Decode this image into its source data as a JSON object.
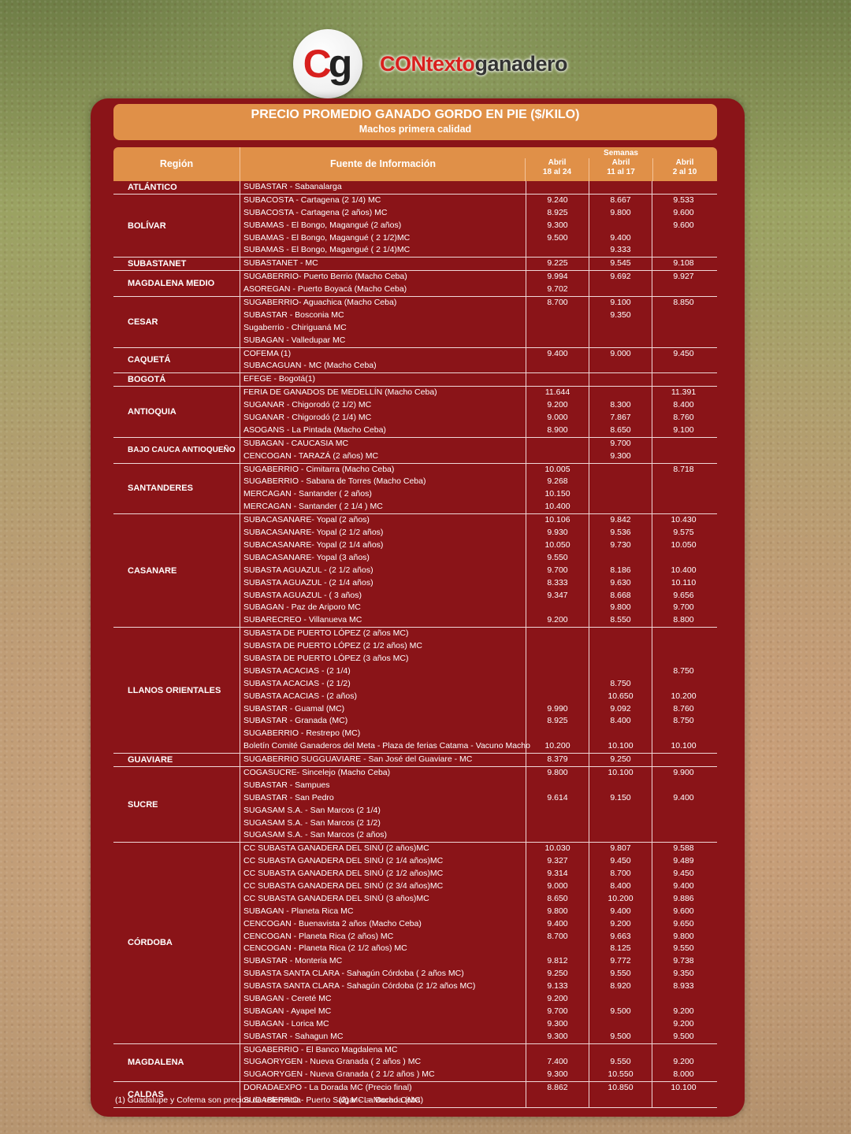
{
  "brand": {
    "logo_c": "C",
    "logo_g": "g",
    "name_red": "CONtexto",
    "name_dark": "ganadero"
  },
  "title": "PRECIO PROMEDIO GANADO GORDO EN PIE ($/KILO)",
  "subtitle": "Machos primera calidad",
  "header": {
    "region": "Región",
    "fuente": "Fuente de Información",
    "semanas": "Semanas",
    "weeks": [
      {
        "month": "Abril",
        "range": "18 al 24"
      },
      {
        "month": "Abril",
        "range": "11 al 17"
      },
      {
        "month": "Abril",
        "range": "2 al 10"
      }
    ]
  },
  "groups": [
    {
      "region": "ATLÁNTICO",
      "rows": [
        [
          "SUBASTAR - Sabanalarga",
          "",
          "",
          ""
        ]
      ]
    },
    {
      "region": "BOLÍVAR",
      "rows": [
        [
          "SUBACOSTA - Cartagena (2 1/4) MC",
          "9.240",
          "8.667",
          "9.533"
        ],
        [
          "SUBACOSTA - Cartagena (2 años) MC",
          "8.925",
          "9.800",
          "9.600"
        ],
        [
          "SUBAMAS - El Bongo, Magangué (2 años)",
          "9.300",
          "",
          "9.600"
        ],
        [
          "SUBAMAS - El Bongo, Magangué ( 2 1/2)MC",
          "9.500",
          "9.400",
          ""
        ],
        [
          "SUBAMAS - El Bongo, Magangué ( 2 1/4)MC",
          "",
          "9.333",
          ""
        ]
      ]
    },
    {
      "region": "SUBASTANET",
      "rows": [
        [
          "SUBASTANET - MC",
          "9.225",
          "9.545",
          "9.108"
        ]
      ]
    },
    {
      "region": "MAGDALENA MEDIO",
      "rows": [
        [
          "SUGABERRIO- Puerto Berrio (Macho Ceba)",
          "9.994",
          "9.692",
          "9.927"
        ],
        [
          "ASOREGAN - Puerto Boyacá (Macho Ceba)",
          "9.702",
          "",
          ""
        ]
      ]
    },
    {
      "region": "CESAR",
      "rows": [
        [
          "SUGABERRIO- Aguachica  (Macho Ceba)",
          "8.700",
          "9.100",
          "8.850"
        ],
        [
          "SUBASTAR - Bosconia MC",
          "",
          "9.350",
          ""
        ],
        [
          "Sugaberrio - Chiriguaná MC",
          "",
          "",
          ""
        ],
        [
          "SUBAGAN - Valledupar MC",
          "",
          "",
          ""
        ]
      ]
    },
    {
      "region": "CAQUETÁ",
      "rows": [
        [
          "COFEMA (1)",
          "9.400",
          "9.000",
          "9.450"
        ],
        [
          "SUBACAGUAN - MC (Macho Ceba)",
          "",
          "",
          ""
        ]
      ]
    },
    {
      "region": "BOGOTÁ",
      "rows": [
        [
          "EFEGE - Bogotá(1)",
          "",
          "",
          ""
        ]
      ]
    },
    {
      "region": "ANTIOQUIA",
      "rows": [
        [
          "FERIA DE GANADOS DE MEDELLÍN (Macho Ceba)",
          "11.644",
          "",
          "11.391"
        ],
        [
          "SUGANAR - Chigorodó (2 1/2) MC",
          "9.200",
          "8.300",
          "8.400"
        ],
        [
          "SUGANAR - Chigorodó (2 1/4) MC",
          "9.000",
          "7.867",
          "8.760"
        ],
        [
          "ASOGANS - La Pintada (Macho Ceba)",
          "8.900",
          "8.650",
          "9.100"
        ]
      ]
    },
    {
      "region": "BAJO CAUCA ANTIOQUEÑO",
      "rows": [
        [
          "SUBAGAN - CAUCASIA MC",
          "",
          "9.700",
          ""
        ],
        [
          "CENCOGAN - TARAZÁ (2 años) MC",
          "",
          "9.300",
          ""
        ]
      ]
    },
    {
      "region": "SANTANDERES",
      "rows": [
        [
          "SUGABERRIO - Cimitarra (Macho Ceba)",
          "10.005",
          "",
          "8.718"
        ],
        [
          "SUGABERRIO - Sabana de Torres (Macho Ceba)",
          "9.268",
          "",
          ""
        ],
        [
          "MERCAGAN - Santander ( 2 años)",
          "10.150",
          "",
          ""
        ],
        [
          "MERCAGAN - Santander ( 2 1/4 ) MC",
          "10.400",
          "",
          ""
        ]
      ]
    },
    {
      "region": "CASANARE",
      "rows": [
        [
          "SUBACASANARE- Yopal (2 años)",
          "10.106",
          "9.842",
          "10.430"
        ],
        [
          "SUBACASANARE- Yopal (2 1/2 años)",
          "9.930",
          "9.536",
          "9.575"
        ],
        [
          "SUBACASANARE- Yopal (2 1/4 años)",
          "10.050",
          "9.730",
          "10.050"
        ],
        [
          "SUBACASANARE- Yopal (3 años)",
          "9.550",
          "",
          ""
        ],
        [
          "SUBASTA AGUAZUL - (2 1/2 años)",
          "9.700",
          "8.186",
          "10.400"
        ],
        [
          "SUBASTA AGUAZUL - (2 1/4 años)",
          "8.333",
          "9.630",
          "10.110"
        ],
        [
          "SUBASTA AGUAZUL - ( 3 años)",
          "9.347",
          "8.668",
          "9.656"
        ],
        [
          "SUBAGAN - Paz de Ariporo MC",
          "",
          "9.800",
          "9.700"
        ],
        [
          "SUBARECREO - Villanueva MC",
          "9.200",
          "8.550",
          "8.800"
        ]
      ]
    },
    {
      "region": "LLANOS ORIENTALES",
      "rows": [
        [
          "SUBASTA DE PUERTO LÓPEZ (2 años MC)",
          "",
          "",
          ""
        ],
        [
          "SUBASTA DE PUERTO LÓPEZ (2 1/2 años) MC",
          "",
          "",
          ""
        ],
        [
          "SUBASTA DE PUERTO LÓPEZ (3 años MC)",
          "",
          "",
          ""
        ],
        [
          "SUBASTA ACACIAS -  (2 1/4)",
          "",
          "",
          "8.750"
        ],
        [
          "SUBASTA ACACIAS - (2 1/2)",
          "",
          "8.750",
          ""
        ],
        [
          "SUBASTA ACACIAS - (2 años)",
          "",
          "10.650",
          "10.200"
        ],
        [
          "SUBASTAR - Guamal (MC)",
          "9.990",
          "9.092",
          "8.760"
        ],
        [
          "SUBASTAR - Granada (MC)",
          "8.925",
          "8.400",
          "8.750"
        ],
        [
          "SUGABERRIO - Restrepo (MC)",
          "",
          "",
          ""
        ],
        [
          "Boletín Comité Ganaderos del Meta - Plaza de ferias Catama - Vacuno Macho",
          "10.200",
          "10.100",
          "10.100"
        ]
      ]
    },
    {
      "region": "GUAVIARE",
      "rows": [
        [
          "SUGABERRIO SUGGUAVIARE - San José del Guaviare - MC",
          "8.379",
          "9.250",
          ""
        ]
      ]
    },
    {
      "region": "SUCRE",
      "rows": [
        [
          "COGASUCRE- Sincelejo (Macho Ceba)",
          "9.800",
          "10.100",
          "9.900"
        ],
        [
          "SUBASTAR - Sampues",
          "",
          "",
          ""
        ],
        [
          "SUBASTAR - San Pedro",
          "9.614",
          "9.150",
          "9.400"
        ],
        [
          "SUGASAM S.A. - San Marcos (2 1/4)",
          "",
          "",
          ""
        ],
        [
          "SUGASAM S.A. - San Marcos (2 1/2)",
          "",
          "",
          ""
        ],
        [
          "SUGASAM S.A. - San Marcos (2 años)",
          "",
          "",
          ""
        ]
      ]
    },
    {
      "region": "CÓRDOBA",
      "rows": [
        [
          "CC SUBASTA GANADERA DEL SINÚ (2 años)MC",
          "10.030",
          "9.807",
          "9.588"
        ],
        [
          "CC SUBASTA GANADERA DEL SINÚ (2 1/4 años)MC",
          "9.327",
          "9.450",
          "9.489"
        ],
        [
          "CC SUBASTA GANADERA DEL SINÚ (2 1/2 años)MC",
          "9.314",
          "8.700",
          "9.450"
        ],
        [
          "CC SUBASTA GANADERA DEL SINÚ (2 3/4 años)MC",
          "9.000",
          "8.400",
          "9.400"
        ],
        [
          "CC SUBASTA GANADERA DEL SINÚ (3 años)MC",
          "8.650",
          "10.200",
          "9.886"
        ],
        [
          "SUBAGAN - Planeta Rica MC",
          "9.800",
          "9.400",
          "9.600"
        ],
        [
          "CENCOGAN - Buenavista 2 años (Macho Ceba)",
          "9.400",
          "9.200",
          "9.650"
        ],
        [
          "CENCOGAN - Planeta Rica (2 años) MC",
          "8.700",
          "9.663",
          "9.800"
        ],
        [
          "CENCOGAN - Planeta Rica (2 1/2 años) MC",
          "",
          "8.125",
          "9.550"
        ],
        [
          "SUBASTAR - Monteria MC",
          "9.812",
          "9.772",
          "9.738"
        ],
        [
          "SUBASTA SANTA CLARA - Sahagún Córdoba ( 2 años MC)",
          "9.250",
          "9.550",
          "9.350"
        ],
        [
          "SUBASTA SANTA CLARA - Sahagún Córdoba (2 1/2 años MC)",
          "9.133",
          "8.920",
          "8.933"
        ],
        [
          "SUBAGAN - Cereté MC",
          "9.200",
          "",
          ""
        ],
        [
          "SUBAGAN - Ayapel MC",
          "9.700",
          "9.500",
          "9.200"
        ],
        [
          "SUBAGAN - Lorica MC",
          "9.300",
          "",
          "9.200"
        ],
        [
          "SUBASTAR - Sahagun MC",
          "9.300",
          "9.500",
          "9.500"
        ]
      ]
    },
    {
      "region": "MAGDALENA",
      "rows": [
        [
          "SUGABERRIO - El Banco Magdalena MC",
          "",
          "",
          ""
        ],
        [
          "SUGAORYGEN - Nueva Granada ( 2 años ) MC",
          "7.400",
          "9.550",
          "9.200"
        ],
        [
          "SUGAORYGEN - Nueva Granada ( 2 1/2 años ) MC",
          "9.300",
          "10.550",
          "8.000"
        ]
      ]
    },
    {
      "region": "CALDAS",
      "rows": [
        [
          "DORADAEXPO - La Dorada MC (Precio final)",
          "8.862",
          "10.850",
          "10.100"
        ],
        [
          "SUGABERRIO - Puerto Salgar - La Dorada (MC)",
          "",
          "",
          ""
        ]
      ]
    }
  ],
  "footnotes": [
    "(1) Guadalupe y Cofema son precios de referencia",
    "(2) MC = Macho Ceba"
  ]
}
